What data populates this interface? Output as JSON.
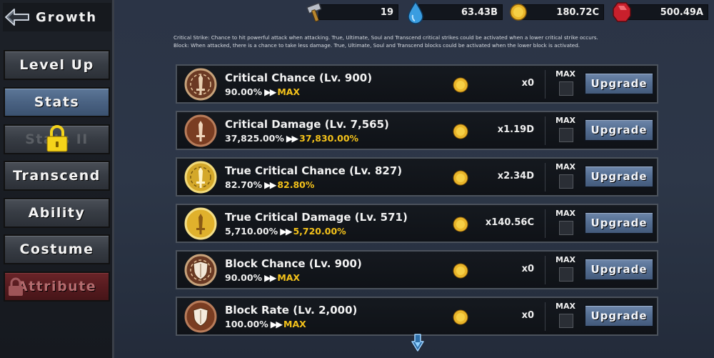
{
  "sidebar": {
    "title": "Growth",
    "items": [
      {
        "label": "Level Up"
      },
      {
        "label": "Stats"
      },
      {
        "label": "Stats II"
      },
      {
        "label": "Transcend"
      },
      {
        "label": "Ability"
      },
      {
        "label": "Costume"
      },
      {
        "label": "Attribute"
      }
    ]
  },
  "currency": [
    {
      "icon": "hammer-icon",
      "value": "19"
    },
    {
      "icon": "water-drop-icon",
      "value": "63.43B"
    },
    {
      "icon": "gold-coin-icon",
      "value": "180.72C"
    },
    {
      "icon": "red-gem-icon",
      "value": "500.49A"
    }
  ],
  "info": {
    "line1": "Critical Strike: Chance to hit powerful attack when attacking. True, Ultimate, Soul and Transcend critical strikes could be activated when a lower critical strike occurs.",
    "line2": "Block: When attacked, there is a chance to take less damage. True, Ultimate, Soul and Transcend blocks could be activated when the lower block is activated."
  },
  "stats": [
    {
      "title": "Critical Chance (Lv. 900)",
      "current": "90.00%",
      "arrows": "▶▶",
      "next": "MAX",
      "cost": "x0",
      "max_label": "MAX",
      "button": "Upgrade",
      "icon": "sword-bronze-icon"
    },
    {
      "title": "Critical Damage (Lv. 7,565)",
      "current": "37,825.00%",
      "arrows": "▶▶",
      "next": "37,830.00%",
      "cost": "x1.19D",
      "max_label": "MAX",
      "button": "Upgrade",
      "icon": "sword-copper-icon"
    },
    {
      "title": "True Critical Chance (Lv. 827)",
      "current": "82.70%",
      "arrows": "▶▶",
      "next": "82.80%",
      "cost": "x2.34D",
      "max_label": "MAX",
      "button": "Upgrade",
      "icon": "sword-gold-ring-icon"
    },
    {
      "title": "True Critical Damage (Lv. 571)",
      "current": "5,710.00%",
      "arrows": "▶▶",
      "next": "5,720.00%",
      "cost": "x140.56C",
      "max_label": "MAX",
      "button": "Upgrade",
      "icon": "sword-gold-icon"
    },
    {
      "title": "Block Chance (Lv. 900)",
      "current": "90.00%",
      "arrows": "▶▶",
      "next": "MAX",
      "cost": "x0",
      "max_label": "MAX",
      "button": "Upgrade",
      "icon": "shield-bronze-icon"
    },
    {
      "title": "Block Rate (Lv. 2,000)",
      "current": "100.00%",
      "arrows": "▶▶",
      "next": "MAX",
      "cost": "x0",
      "max_label": "MAX",
      "button": "Upgrade",
      "icon": "shield-copper-icon"
    }
  ]
}
